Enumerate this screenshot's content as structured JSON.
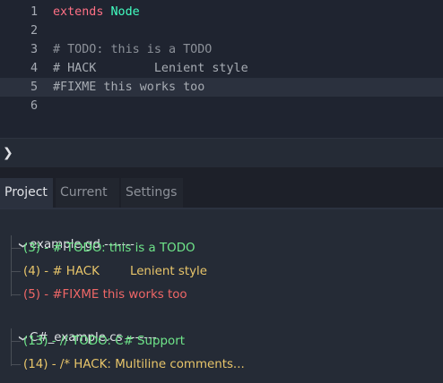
{
  "editor": {
    "lines": [
      {
        "number": "1",
        "keyword": "extends",
        "type": "Node",
        "text": ""
      },
      {
        "number": "2",
        "text": ""
      },
      {
        "number": "3",
        "text": "# TODO: this is a TODO"
      },
      {
        "number": "4",
        "text": "# HACK        Lenient style"
      },
      {
        "number": "5",
        "text": "#FIXME this works too"
      },
      {
        "number": "6",
        "text": ""
      }
    ],
    "current_line": 5
  },
  "panel": {
    "toggle_icon": "chevron-right-icon",
    "toggle_glyph": "❯",
    "tabs": [
      {
        "label": "Project",
        "active": true
      },
      {
        "label": "Current",
        "active": false
      },
      {
        "label": "Settings",
        "active": false
      }
    ]
  },
  "tree": {
    "files": [
      {
        "name": "example.gd -------",
        "items": [
          {
            "text": "(3) - # TODO: this is a TODO",
            "kind": "todo"
          },
          {
            "text": "(4) - # HACK        Lenient style",
            "kind": "hack"
          },
          {
            "text": "(5) - #FIXME this works too",
            "kind": "fixme"
          }
        ]
      },
      {
        "name": "C#_example.cs -------",
        "items": [
          {
            "text": "(13) - // TODO: C# Support",
            "kind": "todo"
          },
          {
            "text": "(14) - /* HACK: Multiline comments...",
            "kind": "hack"
          }
        ]
      }
    ]
  },
  "colors": {
    "todo": "#6fe68a",
    "hack": "#e8c56a",
    "fixme": "#ef6767",
    "keyword": "#ff7085",
    "type": "#42ffc2"
  }
}
